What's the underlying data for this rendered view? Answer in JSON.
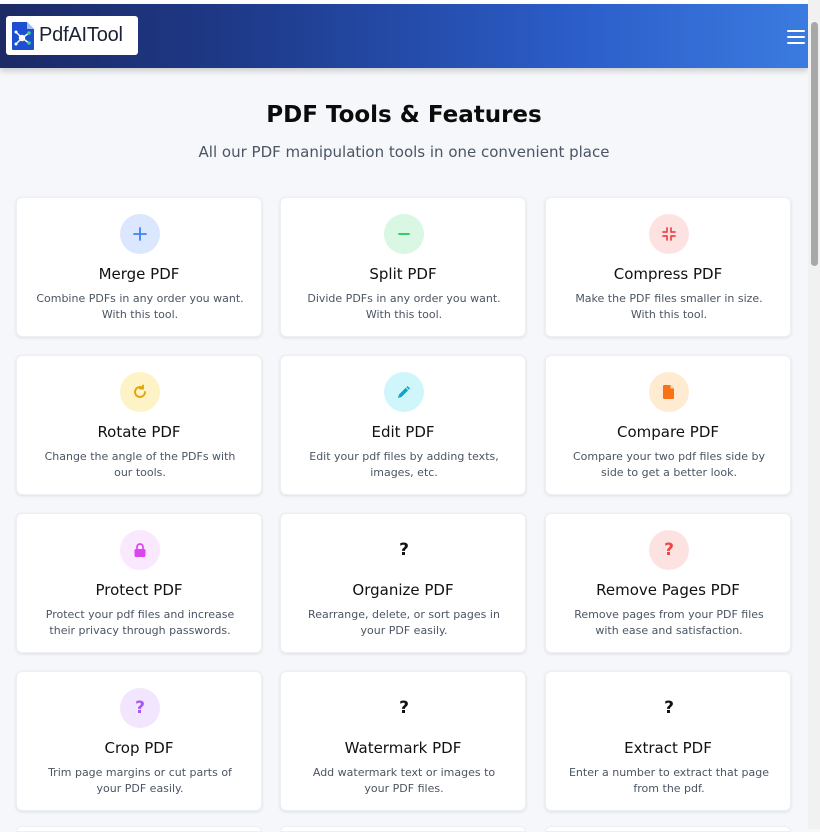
{
  "header": {
    "logo_text": "PdfAITool"
  },
  "hero": {
    "title": "PDF Tools & Features",
    "subtitle": "All our PDF manipulation tools in one convenient place"
  },
  "colors": {
    "header_gradient_start": "#1c2a66",
    "header_gradient_end": "#3b7be0",
    "page_background": "#f5f7fa"
  },
  "tools": [
    {
      "title": "Merge PDF",
      "description": "Combine PDFs in any order you want. With this tool.",
      "icon": "plus-icon",
      "icon_bg": "#dbe7fe",
      "icon_color": "#3b82f6"
    },
    {
      "title": "Split PDF",
      "description": "Divide PDFs in any order you want. With this tool.",
      "icon": "minus-icon",
      "icon_bg": "#d9f7e3",
      "icon_color": "#22c55e"
    },
    {
      "title": "Compress PDF",
      "description": "Make the PDF files smaller in size. With this tool.",
      "icon": "compress-icon",
      "icon_bg": "#fde2e2",
      "icon_color": "#ef4444"
    },
    {
      "title": "Rotate PDF",
      "description": "Change the angle of the PDFs with our tools.",
      "icon": "rotate-icon",
      "icon_bg": "#fdf3c7",
      "icon_color": "#e0a60c"
    },
    {
      "title": "Edit PDF",
      "description": "Edit your pdf files by adding texts, images, etc.",
      "icon": "pencil-icon",
      "icon_bg": "#cff6fb",
      "icon_color": "#0ea5c6"
    },
    {
      "title": "Compare PDF",
      "description": "Compare your two pdf files side by side to get a better look.",
      "icon": "document-icon",
      "icon_bg": "#ffead2",
      "icon_color": "#f97316"
    },
    {
      "title": "Protect PDF",
      "description": "Protect your pdf files and increase their privacy through passwords.",
      "icon": "lock-icon",
      "icon_bg": "#fae8ff",
      "icon_color": "#d946ef"
    },
    {
      "title": "Organize PDF",
      "description": "Rearrange, delete, or sort pages in your PDF easily.",
      "icon": "question-icon",
      "icon_glyph": "?",
      "icon_bg": "#ffffff",
      "icon_color": "#111111"
    },
    {
      "title": "Remove Pages PDF",
      "description": "Remove pages from your PDF files with ease and satisfaction.",
      "icon": "question-icon",
      "icon_glyph": "?",
      "icon_bg": "#fde2e2",
      "icon_color": "#ef4444"
    },
    {
      "title": "Crop PDF",
      "description": "Trim page margins or cut parts of your PDF easily.",
      "icon": "question-icon",
      "icon_glyph": "?",
      "icon_bg": "#f1e6fe",
      "icon_color": "#a855f7"
    },
    {
      "title": "Watermark PDF",
      "description": "Add watermark text or images to your PDF files.",
      "icon": "question-icon",
      "icon_glyph": "?",
      "icon_bg": "#ffffff",
      "icon_color": "#111111"
    },
    {
      "title": "Extract PDF",
      "description": "Enter a number to extract that page from the pdf.",
      "icon": "question-icon",
      "icon_glyph": "?",
      "icon_bg": "#ffffff",
      "icon_color": "#111111"
    }
  ]
}
